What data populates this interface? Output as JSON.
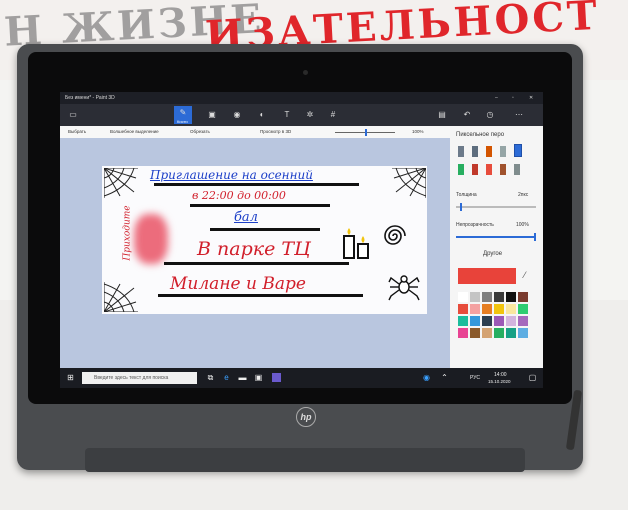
{
  "background": {
    "wall_text_left": "Н ЖИЗНЕ",
    "wall_text_right": "ИЗАТЕЛЬНОСТ"
  },
  "window": {
    "title": "Без имени* - Paint 3D",
    "controls": [
      "–",
      "▫",
      "✕"
    ]
  },
  "toolbar": {
    "active_tool_label": "Кисти",
    "tools": [
      "kisti",
      "2d",
      "3d",
      "sticker",
      "text",
      "effects",
      "canvas"
    ]
  },
  "action_bar": {
    "select": "Выбрать",
    "magic_select": "Волшебное выделение",
    "crop": "Обрезать",
    "view_3d": "Просмотр в 3D",
    "zoom": "100%"
  },
  "card": {
    "line1": "Приглашение на осенний",
    "line2": "в 22:00 до 00:00",
    "line3": "бал",
    "line4": "В парке ТЦ",
    "line5": "Милане и Варе",
    "side_text": "Приходите"
  },
  "side_panel": {
    "heading": "Пиксельное перо",
    "thickness_label": "Толщина",
    "thickness_value": "2пкс",
    "opacity_label": "Непрозрачность",
    "opacity_value": "100%",
    "more_label": "Другое",
    "current_color": "#e8433a",
    "palette": [
      "#ffffff",
      "#c4c4c4",
      "#7f7f7f",
      "#3a3a3a",
      "#111111",
      "#7a3b2e",
      "#e74c3c",
      "#f4a1a1",
      "#e67e22",
      "#f1c40f",
      "#f9e79f",
      "#2ecc71",
      "#1abc9c",
      "#3498db",
      "#2c3e50",
      "#9b59b6",
      "#d2b4de",
      "#a569bd",
      "#e84393",
      "#8b5a2b",
      "#d4a373",
      "#27ae60",
      "#16a085",
      "#5dade2"
    ]
  },
  "taskbar": {
    "search_placeholder": "Введите здесь текст для поиска",
    "time": "14:00",
    "date": "15.10.2020",
    "lang": "РУС"
  },
  "device": {
    "brand": "hp"
  }
}
